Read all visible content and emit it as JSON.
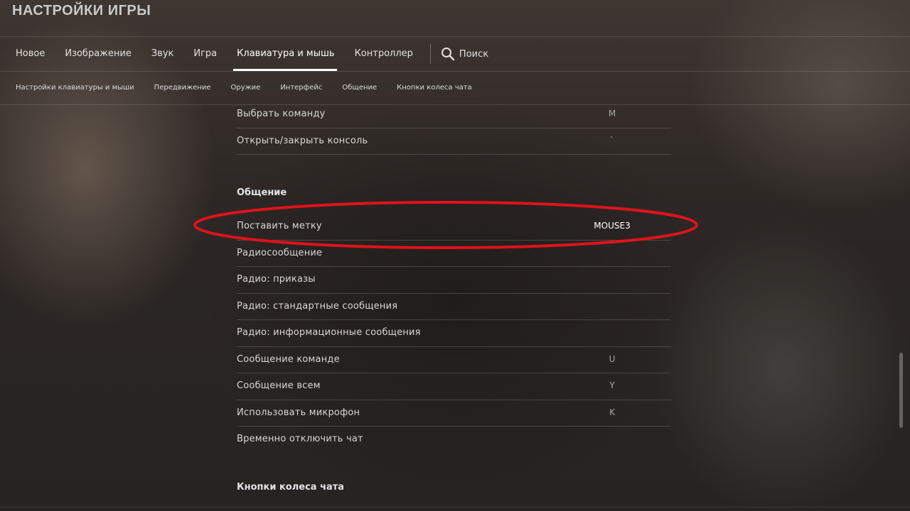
{
  "header": {
    "title": "НАСТРОЙКИ ИГРЫ"
  },
  "tabs": [
    {
      "label": "Новое"
    },
    {
      "label": "Изображение"
    },
    {
      "label": "Звук"
    },
    {
      "label": "Игра"
    },
    {
      "label": "Клавиатура и мышь"
    },
    {
      "label": "Контроллер"
    }
  ],
  "active_tab": "Клавиатура и мышь",
  "search": {
    "label": "Поиск",
    "icon": "search-icon"
  },
  "subtabs": [
    {
      "label": "Настройки клавиатуры и мыши"
    },
    {
      "label": "Передвижение"
    },
    {
      "label": "Оружие"
    },
    {
      "label": "Интерфейс"
    },
    {
      "label": "Общение"
    },
    {
      "label": "Кнопки колеса чата"
    }
  ],
  "rows_top": [
    {
      "label": "Выбрать команду",
      "key": "M"
    },
    {
      "label": "Открыть/закрыть консоль",
      "key": "`"
    }
  ],
  "section_communication": {
    "title": "Общение"
  },
  "rows_communication": [
    {
      "label": "Поставить метку",
      "key": "MOUSE3"
    },
    {
      "label": "Радиосообщение",
      "key": ""
    },
    {
      "label": "Радио: приказы",
      "key": ""
    },
    {
      "label": "Радио: стандартные сообщения",
      "key": ""
    },
    {
      "label": "Радио: информационные сообщения",
      "key": ""
    },
    {
      "label": "Сообщение команде",
      "key": "U"
    },
    {
      "label": "Сообщение всем",
      "key": "Y"
    },
    {
      "label": "Использовать микрофон",
      "key": "K"
    },
    {
      "label": "Временно отключить чат",
      "key": ""
    }
  ],
  "section_chat_wheel": {
    "title": "Кнопки колеса чата"
  },
  "colors": {
    "highlight_ellipse": "#e0121b",
    "active_tab_underline": "#ffffff"
  }
}
